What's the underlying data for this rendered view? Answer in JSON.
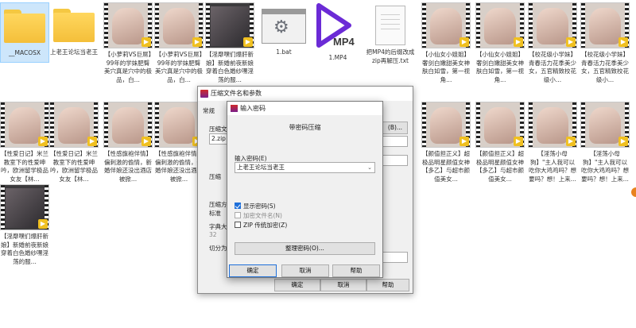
{
  "desktop": {
    "files": [
      {
        "label": "__MACOSX",
        "kind": "folder",
        "selected": true
      },
      {
        "label": "上老王论坛当老王",
        "kind": "folder"
      },
      {
        "label": "【小萝莉VS巨屌】99年的学妹肥臀美穴真是穴中的极品，白...",
        "kind": "video"
      },
      {
        "label": "【小萝莉VS巨屌】99年的学妹肥臀美穴真是穴中的极品，白...",
        "kind": "video"
      },
      {
        "label": "【淫靡嘿们爆肝新娘】新婚前夜新娘穿着白色婚纱嘿淫荡的服...",
        "kind": "video"
      },
      {
        "label": "1.bat",
        "kind": "bat"
      },
      {
        "label": "1.MP4",
        "kind": "mp4"
      },
      {
        "label": "把MP4的后缀改成zip再解压.txt",
        "kind": "txt"
      },
      {
        "label": "【小仙女小姐姐】奢剑白嫩甜美女神肤白如雪，第一视角...",
        "kind": "video"
      },
      {
        "label": "【小仙女小姐姐】奢剑白嫩甜美女神肤白如雪，第一视角...",
        "kind": "video"
      },
      {
        "label": "【校花级小学妹】青春活力花季美少女，五官精致校花级小...",
        "kind": "video"
      },
      {
        "label": "【校花级小学妹】青春活力花季美少女，五官精致校花级小...",
        "kind": "video"
      },
      {
        "label": "【性爱日记】米兰教室下的性爱呻吟，欧洲留学极品女友【林...",
        "kind": "video"
      },
      {
        "label": "【性爱日记】米兰教室下的性爱呻吟，欧洲留学极品女友【林...",
        "kind": "video"
      },
      {
        "label": "【性感旗袍伴情】偏刺激的偷情，新婚伴娘还没出酒店被掀...",
        "kind": "video"
      },
      {
        "label": "【性感旗袍伴情】偏刺激的偷情，新婚伴娘还没出酒店被掀...",
        "kind": "video"
      },
      {
        "label": "【颜值担正义】超极品明星颜值女神【多乙】与超市颜值美女...",
        "kind": "video"
      },
      {
        "label": "【颜值担正义】超极品明星颜值女神【多乙】与超市颜值美女...",
        "kind": "video"
      },
      {
        "label": "【淫荡小母狗】\"主人我可以吃你大鸡鸡吗？想要吗？想！上来...",
        "kind": "video"
      },
      {
        "label": "【淫荡小母狗】\"主人我可以吃你大鸡鸡吗？想要吗？想！上来...",
        "kind": "video"
      },
      {
        "label": "【淫靡嘿们爆肝新娘】新婚前夜新娘穿着白色婚纱嘿淫荡的服...",
        "kind": "video"
      }
    ]
  },
  "archive_dialog": {
    "title": "压缩文件名和参数",
    "tab_general": "常规",
    "archive_name_label": "压缩文",
    "archive_name_value": "2.zip",
    "browse_button": "(B)...",
    "update_mode_label": "压缩",
    "format_label": "压缩方",
    "format_value": "标准",
    "dict_label": "字典大",
    "dict_value": "32",
    "split_label": "切分为",
    "ok_button": "确定",
    "cancel_button": "取消",
    "help_button": "帮助"
  },
  "password_dialog": {
    "title": "输入密码",
    "heading": "带密码压缩",
    "input_label": "输入密码(E)",
    "input_value": "上老王论坛当老王",
    "show_password_label": "显示密码(S)",
    "show_password_checked": true,
    "encrypt_filenames_label": "加密文件名(N)",
    "encrypt_filenames_checked": false,
    "zip_legacy_label": "ZIP 传统加密(Z)",
    "zip_legacy_checked": false,
    "organize_button": "整理密码(O)...",
    "ok_button": "确定",
    "cancel_button": "取消",
    "help_button": "帮助"
  },
  "colors": {
    "accent": "#1e6fd9",
    "folder": "#f4bf3a",
    "mp4_logo": "#6b2bd6"
  }
}
